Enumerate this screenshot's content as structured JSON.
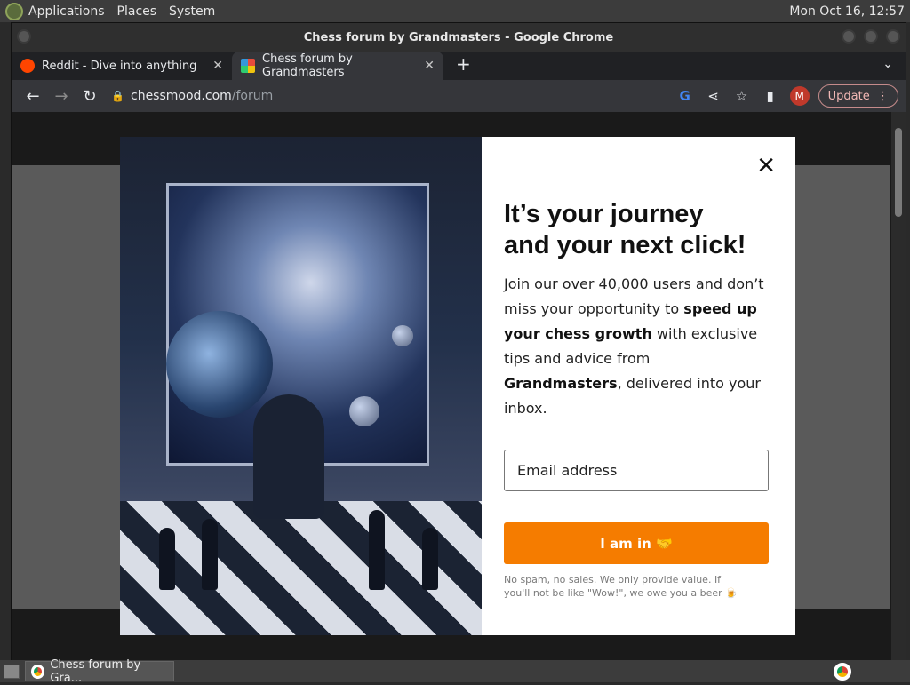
{
  "system_panel": {
    "menus": [
      "Applications",
      "Places",
      "System"
    ],
    "clock": "Mon Oct 16, 12:57"
  },
  "window": {
    "title": "Chess forum by Grandmasters - Google Chrome"
  },
  "tabs": [
    {
      "label": "Reddit - Dive into anything",
      "favicon": "reddit-icon",
      "active": false
    },
    {
      "label": "Chess forum by Grandmasters",
      "favicon": "chess-icon",
      "active": true
    }
  ],
  "toolbar": {
    "url_host": "chessmood.com",
    "url_path": "/forum",
    "avatar_letter": "M",
    "update_label": "Update"
  },
  "modal": {
    "headline": "It’s your journey\nand your next click!",
    "body_parts": [
      {
        "text": "Join our over 40,000 users and don’t miss your opportunity to ",
        "bold": false
      },
      {
        "text": "speed up your chess growth",
        "bold": true
      },
      {
        "text": " with exclusive tips and advice from ",
        "bold": false
      },
      {
        "text": "Grandmasters",
        "bold": true
      },
      {
        "text": ", delivered into your inbox.",
        "bold": false
      }
    ],
    "email_placeholder": "Email address",
    "cta_label": "I am in 🤝",
    "fine_print": "No spam, no sales. We only provide value. If you'll not be like \"Wow!\", we owe you a beer 🍺"
  },
  "taskbar": {
    "task_label": "Chess forum by Gra..."
  }
}
